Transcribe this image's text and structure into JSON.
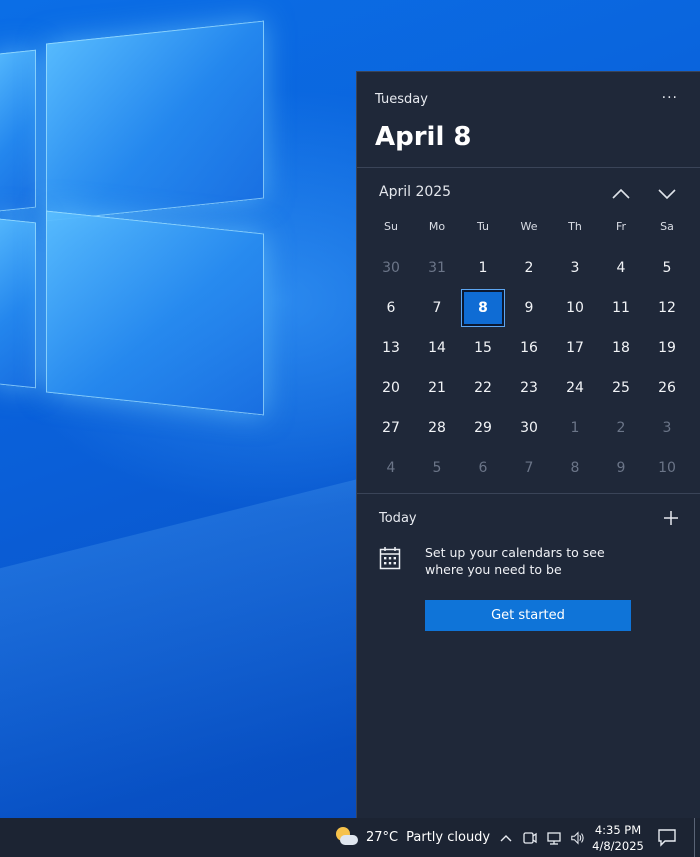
{
  "flyout": {
    "weekday": "Tuesday",
    "date_heading": "April 8",
    "more_label": "···",
    "month_label": "April 2025",
    "days_of_week": [
      "Su",
      "Mo",
      "Tu",
      "We",
      "Th",
      "Fr",
      "Sa"
    ],
    "weeks": [
      [
        {
          "d": "30",
          "other": true
        },
        {
          "d": "31",
          "other": true
        },
        {
          "d": "1"
        },
        {
          "d": "2"
        },
        {
          "d": "3"
        },
        {
          "d": "4"
        },
        {
          "d": "5"
        }
      ],
      [
        {
          "d": "6"
        },
        {
          "d": "7"
        },
        {
          "d": "8",
          "today": true
        },
        {
          "d": "9"
        },
        {
          "d": "10"
        },
        {
          "d": "11"
        },
        {
          "d": "12"
        }
      ],
      [
        {
          "d": "13"
        },
        {
          "d": "14"
        },
        {
          "d": "15"
        },
        {
          "d": "16"
        },
        {
          "d": "17"
        },
        {
          "d": "18"
        },
        {
          "d": "19"
        }
      ],
      [
        {
          "d": "20"
        },
        {
          "d": "21"
        },
        {
          "d": "22"
        },
        {
          "d": "23"
        },
        {
          "d": "24"
        },
        {
          "d": "25"
        },
        {
          "d": "26"
        }
      ],
      [
        {
          "d": "27"
        },
        {
          "d": "28"
        },
        {
          "d": "29"
        },
        {
          "d": "30"
        },
        {
          "d": "1",
          "other": true
        },
        {
          "d": "2",
          "other": true
        },
        {
          "d": "3",
          "other": true
        }
      ],
      [
        {
          "d": "4",
          "other": true
        },
        {
          "d": "5",
          "other": true
        },
        {
          "d": "6",
          "other": true
        },
        {
          "d": "7",
          "other": true
        },
        {
          "d": "8",
          "other": true
        },
        {
          "d": "9",
          "other": true
        },
        {
          "d": "10",
          "other": true
        }
      ]
    ],
    "today_label": "Today",
    "setup_text": "Set up your calendars to see where you need to be",
    "get_started_label": "Get started"
  },
  "taskbar": {
    "temperature": "27°C",
    "condition": "Partly cloudy",
    "time": "4:35 PM",
    "date": "4/8/2025"
  },
  "colors": {
    "flyout_bg": "#1f2839",
    "accent": "#0f74d8",
    "taskbar_bg": "#1c2433",
    "desktop_blue": "#0a5fd8"
  }
}
